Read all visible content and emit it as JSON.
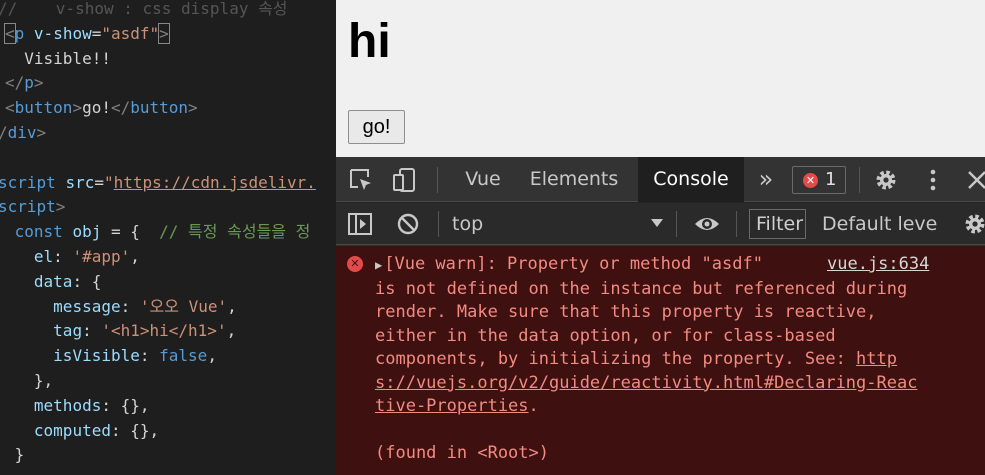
{
  "editor": {
    "lines": [
      [
        [
          "ghost",
          "//    v-show : css display 속성"
        ]
      ],
      [
        [
          "punc",
          "<"
        ],
        [
          "tag",
          "p"
        ],
        [
          "text",
          " "
        ],
        [
          "attr",
          "v-show"
        ],
        [
          "text",
          "="
        ],
        [
          "str",
          "\"asdf\""
        ],
        [
          "punc",
          ">"
        ]
      ],
      [
        [
          "text",
          "  Visible!!"
        ]
      ],
      [
        [
          "punc",
          "</"
        ],
        [
          "tag",
          "p"
        ],
        [
          "punc",
          ">"
        ]
      ],
      [
        [
          "punc",
          "<"
        ],
        [
          "tag",
          "button"
        ],
        [
          "punc",
          ">"
        ],
        [
          "text",
          "go!"
        ],
        [
          "punc",
          "</"
        ],
        [
          "tag",
          "button"
        ],
        [
          "punc",
          ">"
        ]
      ],
      [
        [
          "punc",
          "/"
        ],
        [
          "tag",
          "div"
        ],
        [
          "punc",
          ">"
        ]
      ],
      [
        [
          "text",
          ""
        ]
      ],
      [
        [
          "tag",
          "script"
        ],
        [
          "text",
          " "
        ],
        [
          "attr",
          "src"
        ],
        [
          "text",
          "="
        ],
        [
          "str",
          "\""
        ],
        [
          "link",
          "https://cdn.jsdelivr."
        ]
      ],
      [
        [
          "tag",
          "script"
        ],
        [
          "punc",
          ">"
        ]
      ],
      [
        [
          "text",
          " "
        ],
        [
          "kw",
          "const"
        ],
        [
          "text",
          " "
        ],
        [
          "var",
          "obj"
        ],
        [
          "text",
          " = {  "
        ],
        [
          "cmt",
          "// 특정 속성들을 정"
        ]
      ],
      [
        [
          "text",
          "   "
        ],
        [
          "var",
          "el"
        ],
        [
          "text",
          ": "
        ],
        [
          "str",
          "'#app'"
        ],
        [
          "text",
          ","
        ]
      ],
      [
        [
          "text",
          "   "
        ],
        [
          "var",
          "data"
        ],
        [
          "text",
          ": {"
        ]
      ],
      [
        [
          "text",
          "     "
        ],
        [
          "var",
          "message"
        ],
        [
          "text",
          ": "
        ],
        [
          "str",
          "'오오 Vue'"
        ],
        [
          "text",
          ","
        ]
      ],
      [
        [
          "text",
          "     "
        ],
        [
          "var",
          "tag"
        ],
        [
          "text",
          ": "
        ],
        [
          "str",
          "'<h1>hi</h1>'"
        ],
        [
          "text",
          ","
        ]
      ],
      [
        [
          "text",
          "     "
        ],
        [
          "var",
          "isVisible"
        ],
        [
          "text",
          ": "
        ],
        [
          "bool",
          "false"
        ],
        [
          "text",
          ","
        ]
      ],
      [
        [
          "text",
          "   },"
        ]
      ],
      [
        [
          "text",
          "   "
        ],
        [
          "var",
          "methods"
        ],
        [
          "text",
          ": {},"
        ]
      ],
      [
        [
          "text",
          "   "
        ],
        [
          "var",
          "computed"
        ],
        [
          "text",
          ": {},"
        ]
      ],
      [
        [
          "text",
          " }"
        ]
      ]
    ]
  },
  "preview": {
    "heading": "hi",
    "button_label": "go!"
  },
  "devtools": {
    "tabs": [
      {
        "label": "Vue",
        "active": false
      },
      {
        "label": "Elements",
        "active": false
      },
      {
        "label": "Console",
        "active": true
      }
    ],
    "more_tabs_label": "»",
    "error_count": "1",
    "context": "top",
    "filter_label": "Filter",
    "levels_label": "Default levels",
    "message": {
      "lines": [
        "[Vue warn]: Property or method \"asdf\"",
        "is not defined on the instance but referenced during",
        "render. Make sure that this property is reactive,",
        "either in the data option, or for class-based",
        "components, by initializing the property. See: http",
        "s://vuejs.org/v2/guide/reactivity.html#Declaring-Reac",
        "tive-Properties.",
        "",
        "(found in <Root>)"
      ],
      "link_lines": [
        4,
        5,
        6
      ],
      "source": "vue.js:634"
    },
    "colors": {
      "error_bg": "#3f1010",
      "error_text": "#f28b82",
      "error_icon": "#e34b4b"
    }
  }
}
